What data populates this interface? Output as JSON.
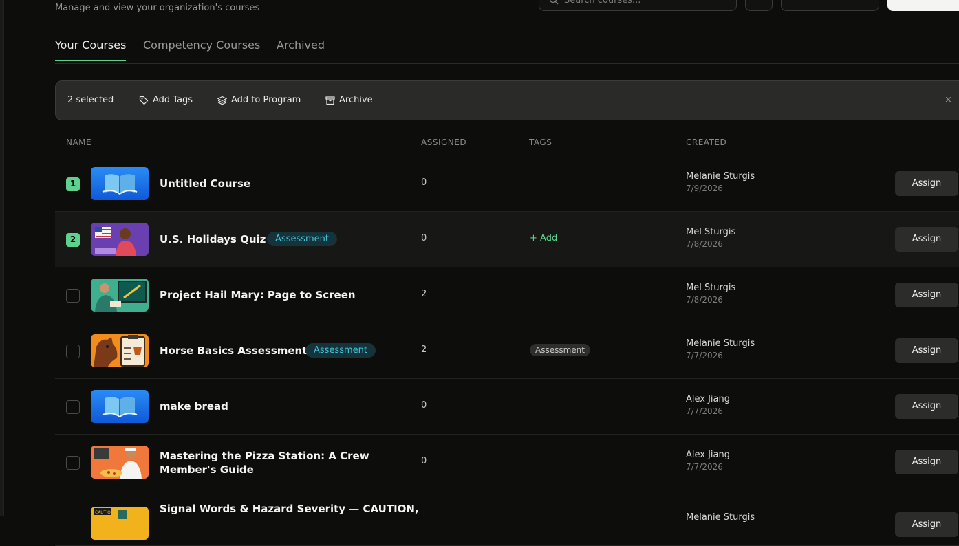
{
  "header": {
    "subtitle": "Manage and view your organization's courses",
    "search_placeholder": "Search courses..."
  },
  "tabs": [
    {
      "label": "Your Courses",
      "active": true
    },
    {
      "label": "Competency Courses",
      "active": false
    },
    {
      "label": "Archived",
      "active": false
    }
  ],
  "selection_bar": {
    "count_text": "2 selected",
    "actions": [
      "Add Tags",
      "Add to Program",
      "Archive"
    ],
    "close_icon": "close-icon"
  },
  "table": {
    "columns": [
      "NAME",
      "ASSIGNED",
      "TAGS",
      "CREATED"
    ],
    "rows": [
      {
        "selected": true,
        "selection_index": "1",
        "title": "Untitled Course",
        "badge": "",
        "assigned": "0",
        "tag": "",
        "tag_add": "",
        "creator": "Melanie Sturgis",
        "date": "7/9/2026",
        "assign_label": "Assign",
        "thumb": "book"
      },
      {
        "selected": true,
        "selection_index": "2",
        "title": "U.S. Holidays Quiz",
        "badge": "Assessment",
        "assigned": "0",
        "tag": "",
        "tag_add": "+ Add",
        "creator": "Mel Sturgis",
        "date": "7/8/2026",
        "assign_label": "Assign",
        "thumb": "flag"
      },
      {
        "selected": false,
        "selection_index": "",
        "title": "Project Hail Mary: Page to Screen",
        "badge": "",
        "assigned": "2",
        "tag": "",
        "tag_add": "",
        "creator": "Mel Sturgis",
        "date": "7/8/2026",
        "assign_label": "Assign",
        "thumb": "screen"
      },
      {
        "selected": false,
        "selection_index": "",
        "title": "Horse Basics Assessment",
        "badge": "Assessment",
        "assigned": "2",
        "tag": "Assessment",
        "tag_add": "",
        "creator": "Melanie Sturgis",
        "date": "7/7/2026",
        "assign_label": "Assign",
        "thumb": "horse"
      },
      {
        "selected": false,
        "selection_index": "",
        "title": "make bread",
        "badge": "",
        "assigned": "0",
        "tag": "",
        "tag_add": "",
        "creator": "Alex Jiang",
        "date": "7/7/2026",
        "assign_label": "Assign",
        "thumb": "book"
      },
      {
        "selected": false,
        "selection_index": "",
        "title": "Mastering the Pizza Station: A Crew Member's Guide",
        "badge": "",
        "assigned": "0",
        "tag": "",
        "tag_add": "",
        "creator": "Alex Jiang",
        "date": "7/7/2026",
        "assign_label": "Assign",
        "thumb": "pizza"
      },
      {
        "selected": false,
        "selection_index": "",
        "title": "Signal Words & Hazard Severity — CAUTION,",
        "badge": "",
        "assigned": "",
        "tag": "",
        "tag_add": "",
        "creator": "Melanie Sturgis",
        "date": "",
        "assign_label": "Assign",
        "thumb": "caution"
      }
    ]
  }
}
